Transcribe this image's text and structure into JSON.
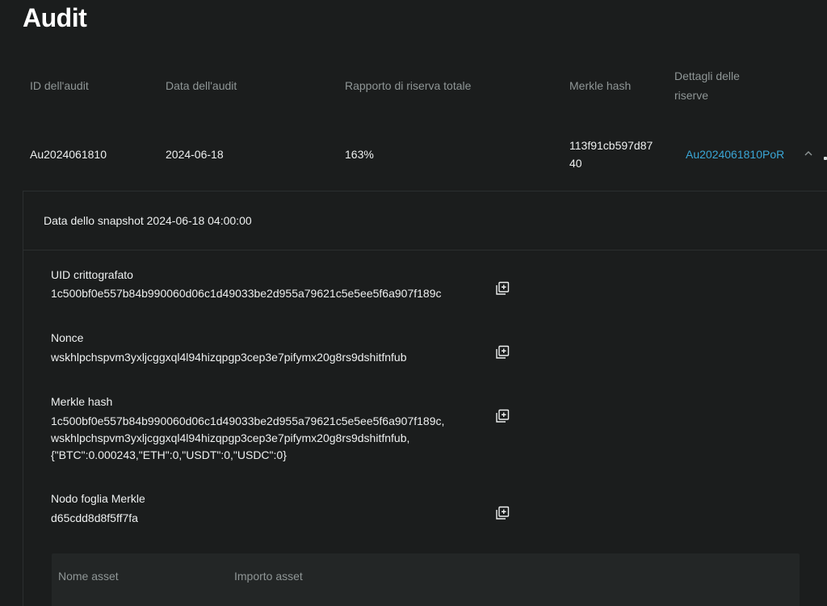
{
  "page": {
    "title": "Audit"
  },
  "table": {
    "headers": {
      "audit_id": "ID dell'audit",
      "audit_date": "Data dell'audit",
      "reserve_ratio": "Rapporto di riserva totale",
      "merkle_hash": "Merkle hash",
      "reserve_details_line1": "Dettagli delle",
      "reserve_details_line2": "riserve"
    },
    "row": {
      "audit_id": "Au2024061810",
      "audit_date": "2024-06-18",
      "reserve_ratio": "163%",
      "merkle_hash_line1": "113f91cb597d87",
      "merkle_hash_line2": "40",
      "reserve_details_link": "Au2024061810PoR"
    }
  },
  "detail": {
    "snapshot": "Data dello snapshot 2024-06-18 04:00:00",
    "fields": [
      {
        "label": "UID crittografato",
        "value": "1c500bf0e557b84b990060d06c1d49033be2d955a79621c5e5ee5f6a907f189c"
      },
      {
        "label": "Nonce",
        "value": "wskhlpchspvm3yxljcggxql4l94hizqpgp3cep3e7pifymx20g8rs9dshitfnfub"
      },
      {
        "label": "Merkle hash",
        "value_lines": [
          "1c500bf0e557b84b990060d06c1d49033be2d955a79621c5e5ee5f6a907f189c,",
          "wskhlpchspvm3yxljcggxql4l94hizqpgp3cep3e7pifymx20g8rs9dshitfnfub,",
          "{\"BTC\":0.000243,\"ETH\":0,\"USDT\":0,\"USDC\":0}"
        ]
      },
      {
        "label": "Nodo foglia Merkle",
        "value": "d65cdd8d8f5ff7fa"
      }
    ],
    "asset_table": {
      "headers": {
        "asset_name": "Nome asset",
        "asset_amount": "Importo asset"
      }
    }
  },
  "icons": {
    "copy": "copy-plus-icon",
    "collapse": "chevron-up-icon"
  },
  "colors": {
    "background": "#1b1d1d",
    "link": "#3aa6d6",
    "muted": "#8f9696",
    "text": "#eef0f0"
  }
}
